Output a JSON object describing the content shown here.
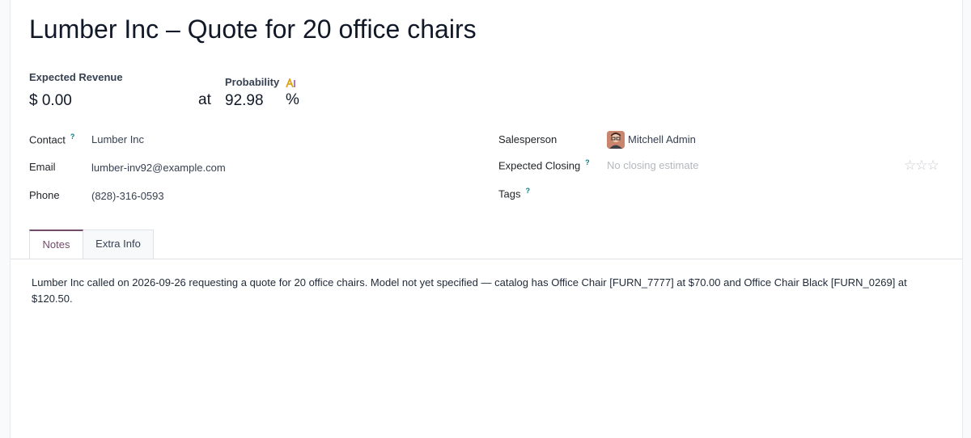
{
  "record": {
    "title": "Lumber Inc – Quote for 20 office chairs"
  },
  "revenue": {
    "label": "Expected Revenue",
    "value": "$ 0.00",
    "at": "at"
  },
  "probability": {
    "label": "Probability",
    "value": "92.98",
    "unit": "%",
    "icon": "ai-sparkle-icon"
  },
  "left_fields": {
    "contact_label": "Contact",
    "contact_value": "Lumber Inc",
    "email_label": "Email",
    "email_value": "lumber-inv92@example.com",
    "phone_label": "Phone",
    "phone_value": "(828)-316-0593"
  },
  "right_fields": {
    "salesperson_label": "Salesperson",
    "salesperson_value": "Mitchell Admin",
    "closing_label": "Expected Closing",
    "closing_placeholder": "No closing estimate",
    "tags_label": "Tags",
    "priority_stars": 0,
    "priority_max": 3
  },
  "help_mark": "?",
  "tabs": [
    {
      "label": "Notes",
      "active": true
    },
    {
      "label": "Extra Info",
      "active": false
    }
  ],
  "notes": {
    "text": "Lumber Inc called on 2026-09-26 requesting a quote for 20 office chairs. Model not yet specified — catalog has Office Chair [FURN_7777] at $70.00 and Office Chair Black [FURN_0269] at $120.50."
  },
  "colors": {
    "accent": "#714b67",
    "help": "#017e84",
    "placeholder": "#b3b8bf"
  }
}
